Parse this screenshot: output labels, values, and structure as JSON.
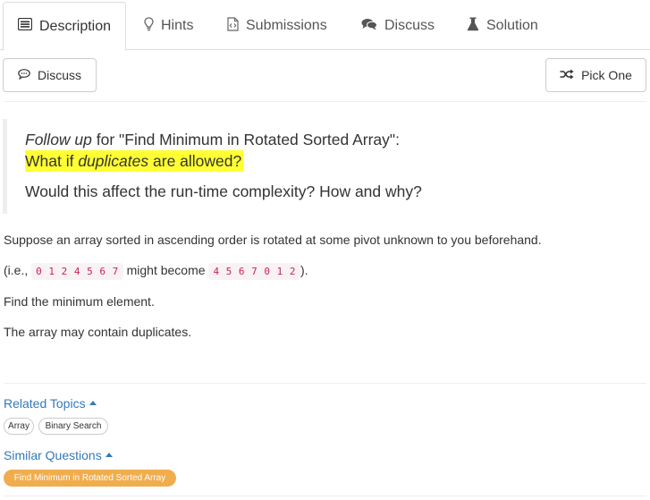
{
  "tabs": [
    {
      "label": "Description",
      "icon": "list-icon"
    },
    {
      "label": "Hints",
      "icon": "lightbulb-icon"
    },
    {
      "label": "Submissions",
      "icon": "code-file-icon"
    },
    {
      "label": "Discuss",
      "icon": "comments-icon"
    },
    {
      "label": "Solution",
      "icon": "flask-icon"
    }
  ],
  "toolbar": {
    "discuss_label": "Discuss",
    "pick_one_label": "Pick One"
  },
  "quote": {
    "follow_up": "Follow up",
    "for_text": " for \"Find Minimum in Rotated Sorted Array\":",
    "what_if": "What if ",
    "duplicates": "duplicates",
    "are_allowed": " are allowed?",
    "would": "Would this affect the run-time complexity? How and why?"
  },
  "problem": {
    "line1": "Suppose an array sorted in ascending order is rotated at some pivot unknown to you beforehand.",
    "ie_prefix": "(i.e., ",
    "code1": "0 1 2 4 5 6 7",
    "might_become": " might become ",
    "code2": "4 5 6 7 0 1 2",
    "ie_suffix": ").",
    "line3": "Find the minimum element.",
    "line4": "The array may contain duplicates."
  },
  "related": {
    "title": "Related Topics",
    "tags": [
      "Array",
      "Binary Search"
    ]
  },
  "similar": {
    "title": "Similar Questions",
    "items": [
      "Find Minimum in Rotated Sorted Array"
    ]
  },
  "colors": {
    "link": "#337ab7",
    "highlight": "#ffff33",
    "code_text": "#c7254e",
    "orange_tag": "#f0ad4e"
  }
}
